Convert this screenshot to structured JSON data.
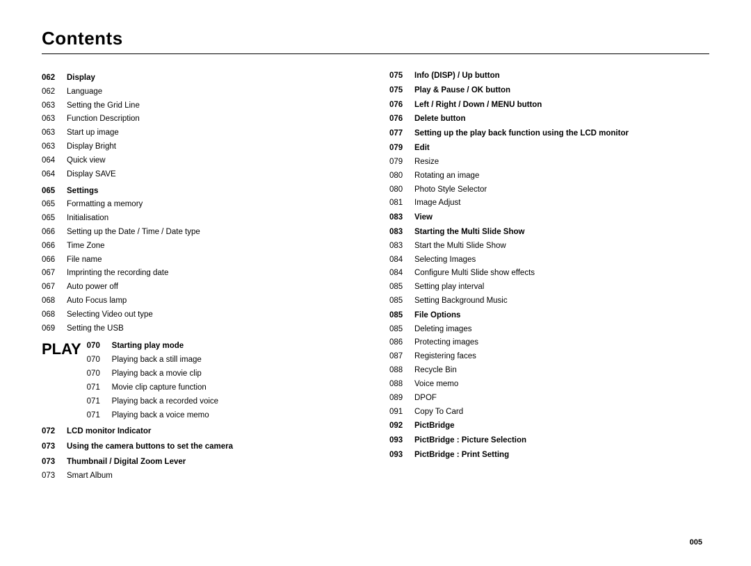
{
  "title": "Contents",
  "footer": "005",
  "left_column": {
    "sections": [
      {
        "page": "062",
        "label": "Display",
        "bold": true,
        "items": [
          {
            "page": "062",
            "text": "Language"
          },
          {
            "page": "063",
            "text": "Setting the Grid Line"
          },
          {
            "page": "063",
            "text": "Function Description"
          },
          {
            "page": "063",
            "text": "Start up image"
          },
          {
            "page": "063",
            "text": "Display Bright"
          },
          {
            "page": "064",
            "text": "Quick view"
          },
          {
            "page": "064",
            "text": "Display SAVE"
          }
        ]
      },
      {
        "page": "065",
        "label": "Settings",
        "bold": true,
        "items": [
          {
            "page": "065",
            "text": "Formatting a memory"
          },
          {
            "page": "065",
            "text": "Initialisation"
          },
          {
            "page": "066",
            "text": "Setting up the Date / Time / Date type"
          },
          {
            "page": "066",
            "text": "Time Zone"
          },
          {
            "page": "066",
            "text": "File name"
          },
          {
            "page": "067",
            "text": "Imprinting the recording date"
          },
          {
            "page": "067",
            "text": "Auto power off"
          },
          {
            "page": "068",
            "text": "Auto Focus lamp"
          },
          {
            "page": "068",
            "text": "Selecting Video out type"
          },
          {
            "page": "069",
            "text": "Setting the USB"
          }
        ]
      }
    ],
    "play_section": {
      "play_label": "PLAY",
      "page": "070",
      "label": "Starting play mode",
      "items": [
        {
          "page": "070",
          "text": "Playing back a still image"
        },
        {
          "page": "070",
          "text": "Playing back a movie clip"
        },
        {
          "page": "071",
          "text": "Movie clip capture function"
        },
        {
          "page": "071",
          "text": "Playing back a recorded voice"
        },
        {
          "page": "071",
          "text": "Playing back a voice memo"
        }
      ]
    },
    "bottom_sections": [
      {
        "page": "072",
        "label": "LCD monitor Indicator",
        "bold": true,
        "items": []
      },
      {
        "page": "073",
        "label": "Using the camera buttons to set the camera",
        "bold": true,
        "items": []
      },
      {
        "page": "073",
        "label": "Thumbnail / Digital Zoom  Lever",
        "bold": true,
        "items": [
          {
            "page": "073",
            "text": "Smart Album"
          }
        ]
      }
    ]
  },
  "right_column": {
    "sections": [
      {
        "page": "075",
        "label": "Info (DISP) / Up button",
        "bold": true,
        "items": []
      },
      {
        "page": "075",
        "label": "Play & Pause / OK button",
        "bold": true,
        "items": []
      },
      {
        "page": "076",
        "label": "Left / Right / Down / MENU button",
        "bold": true,
        "items": []
      },
      {
        "page": "076",
        "label": "Delete button",
        "bold": true,
        "items": []
      },
      {
        "page": "077",
        "label": "Setting up the play back function using the LCD monitor",
        "bold": true,
        "multiline": true,
        "items": []
      },
      {
        "page": "079",
        "label": "Edit",
        "bold": true,
        "items": [
          {
            "page": "079",
            "text": "Resize"
          },
          {
            "page": "080",
            "text": "Rotating an image"
          },
          {
            "page": "080",
            "text": "Photo Style Selector"
          },
          {
            "page": "081",
            "text": "Image Adjust"
          }
        ]
      },
      {
        "page": "083",
        "label": "View",
        "bold": true,
        "items": []
      },
      {
        "page": "083",
        "label": "Starting the Multi Slide Show",
        "bold": true,
        "items": [
          {
            "page": "083",
            "text": "Start the Multi Slide Show"
          },
          {
            "page": "084",
            "text": "Selecting Images"
          },
          {
            "page": "084",
            "text": "Configure Multi Slide show effects"
          },
          {
            "page": "085",
            "text": "Setting play interval"
          },
          {
            "page": "085",
            "text": "Setting Background Music"
          }
        ]
      },
      {
        "page": "085",
        "label": "File Options",
        "bold": true,
        "items": [
          {
            "page": "085",
            "text": "Deleting images"
          },
          {
            "page": "086",
            "text": "Protecting images"
          },
          {
            "page": "087",
            "text": "Registering faces"
          },
          {
            "page": "088",
            "text": "Recycle Bin"
          },
          {
            "page": "088",
            "text": "Voice memo"
          },
          {
            "page": "089",
            "text": "DPOF"
          },
          {
            "page": "091",
            "text": "Copy To Card"
          }
        ]
      },
      {
        "page": "092",
        "label": "PictBridge",
        "bold": true,
        "items": []
      },
      {
        "page": "093",
        "label": "PictBridge : Picture Selection",
        "bold": true,
        "items": []
      },
      {
        "page": "093",
        "label": "PictBridge : Print Setting",
        "bold": true,
        "items": []
      }
    ]
  }
}
